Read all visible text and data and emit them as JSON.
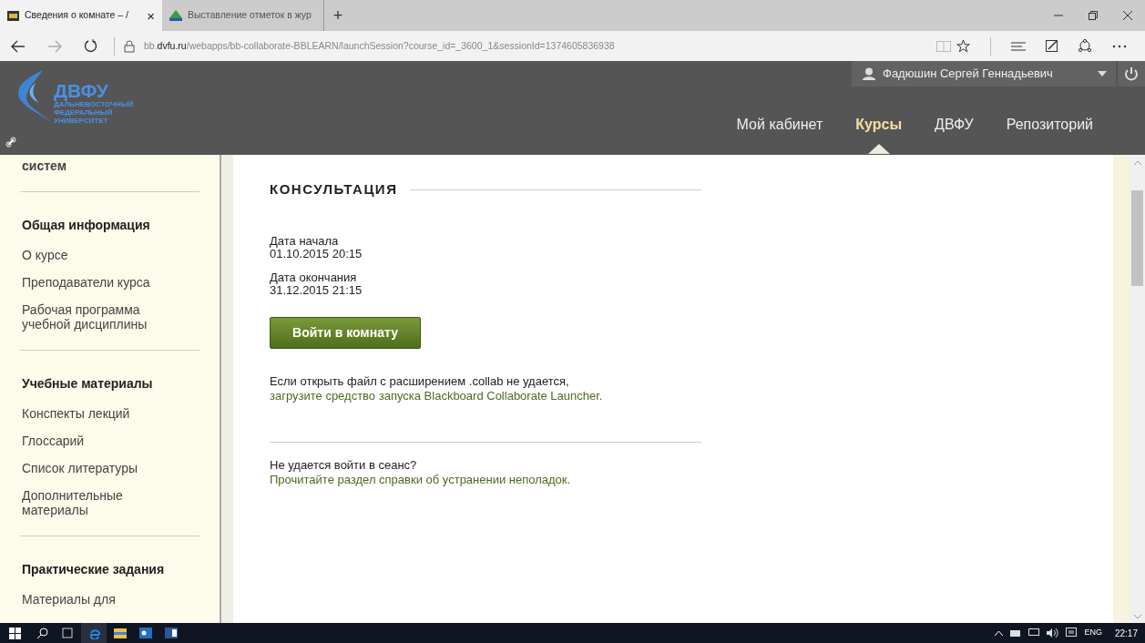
{
  "browser": {
    "tabs": [
      {
        "title": "Сведения о комнате – /",
        "selected": true,
        "close": "×"
      },
      {
        "title": "Выставление отметок в жур",
        "selected": false
      }
    ],
    "new_tab": "+",
    "url_host_prefix": "bb.",
    "url_host": "dvfu.ru",
    "url_path": "/webapps/bb-collaborate-BBLEARN/launchSession?course_id=_3600_1&sessionId=1374605836938"
  },
  "header": {
    "logo_title": "ДВФУ",
    "logo_lines": [
      "ДАЛЬНЕВОСТОЧНЫЙ",
      "ФЕДЕРАЛЬНЫЙ",
      "УНИВЕРСИТЕТ"
    ],
    "user": "Фадюшин Сергей Геннадьевич",
    "nav": [
      {
        "label": "Мой кабинет",
        "selected": false
      },
      {
        "label": "Курсы",
        "selected": true
      },
      {
        "label": "ДВФУ",
        "selected": false
      },
      {
        "label": "Репозиторий",
        "selected": false
      }
    ]
  },
  "sidebar": {
    "sections": [
      {
        "items": [
          "систем"
        ]
      },
      {
        "heading": "Общая информация",
        "items": [
          "О курсе",
          "Преподаватели курса",
          "Рабочая программа учебной дисциплины"
        ]
      },
      {
        "heading": "Учебные материалы",
        "items": [
          "Конспекты лекций",
          "Глоссарий",
          "Список литературы",
          "Дополнительные материалы"
        ]
      },
      {
        "heading": "Практические задания",
        "items": [
          "Материалы для"
        ]
      }
    ]
  },
  "main": {
    "title": "КОНСУЛЬТАЦИЯ",
    "fields": [
      {
        "label": "Дата начала",
        "value": "01.10.2015 20:15"
      },
      {
        "label": "Дата окончания",
        "value": "31.12.2015 21:15"
      }
    ],
    "button": "Войти в комнату",
    "note": "Если открыть файл с расширением .collab не удается, ",
    "note_link": "загрузите средство запуска Blackboard Collaborate Launcher.",
    "help": "Не удается войти в сеанс? ",
    "help_link": "Прочитайте раздел справки об устранении неполадок."
  },
  "taskbar": {
    "lang": "ENG",
    "time": "22:17"
  }
}
